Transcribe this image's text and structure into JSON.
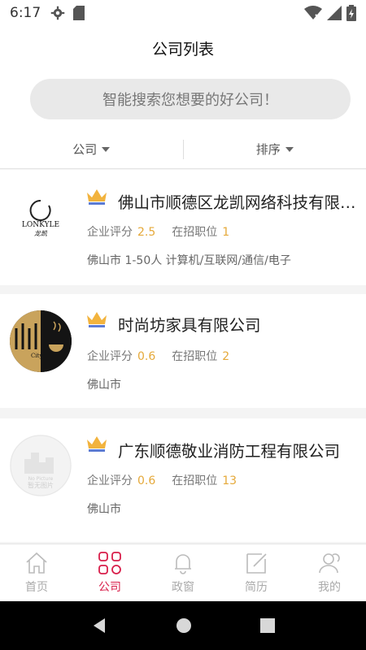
{
  "status_bar": {
    "time": "6:17"
  },
  "header": {
    "title": "公司列表"
  },
  "search": {
    "placeholder": "智能搜索您想要的好公司！"
  },
  "filters": [
    {
      "label": "公司"
    },
    {
      "label": "排序"
    }
  ],
  "companies": [
    {
      "name": "佛山市顺德区龙凯网络科技有限公司",
      "rating_label": "企业评分",
      "rating": "2.5",
      "jobs_label": "在招职位",
      "jobs": "1",
      "tags": "佛山市 1-50人 计算机/互联网/通信/电子",
      "logo_text_top": "LONKYLE",
      "logo_text_bottom": "龙凯"
    },
    {
      "name": "时尚坊家具有限公司",
      "rating_label": "企业评分",
      "rating": "0.6",
      "jobs_label": "在招职位",
      "jobs": "2",
      "tags": "佛山市",
      "logo_text": "City"
    },
    {
      "name": "广东顺德敬业消防工程有限公司",
      "rating_label": "企业评分",
      "rating": "0.6",
      "jobs_label": "在招职位",
      "jobs": "13",
      "tags": "佛山市",
      "logo_text_top": "No Picture",
      "logo_text_bottom": "暂无图片"
    }
  ],
  "tabs": [
    {
      "label": "首页",
      "icon": "home-icon"
    },
    {
      "label": "公司",
      "icon": "company-grid-icon",
      "active": true
    },
    {
      "label": "政窗",
      "icon": "bell-icon"
    },
    {
      "label": "简历",
      "icon": "edit-icon"
    },
    {
      "label": "我的",
      "icon": "user-icon"
    }
  ],
  "colors": {
    "accent": "#d81e4a",
    "rating": "#e5a93a",
    "crown": "#f2b33d"
  }
}
